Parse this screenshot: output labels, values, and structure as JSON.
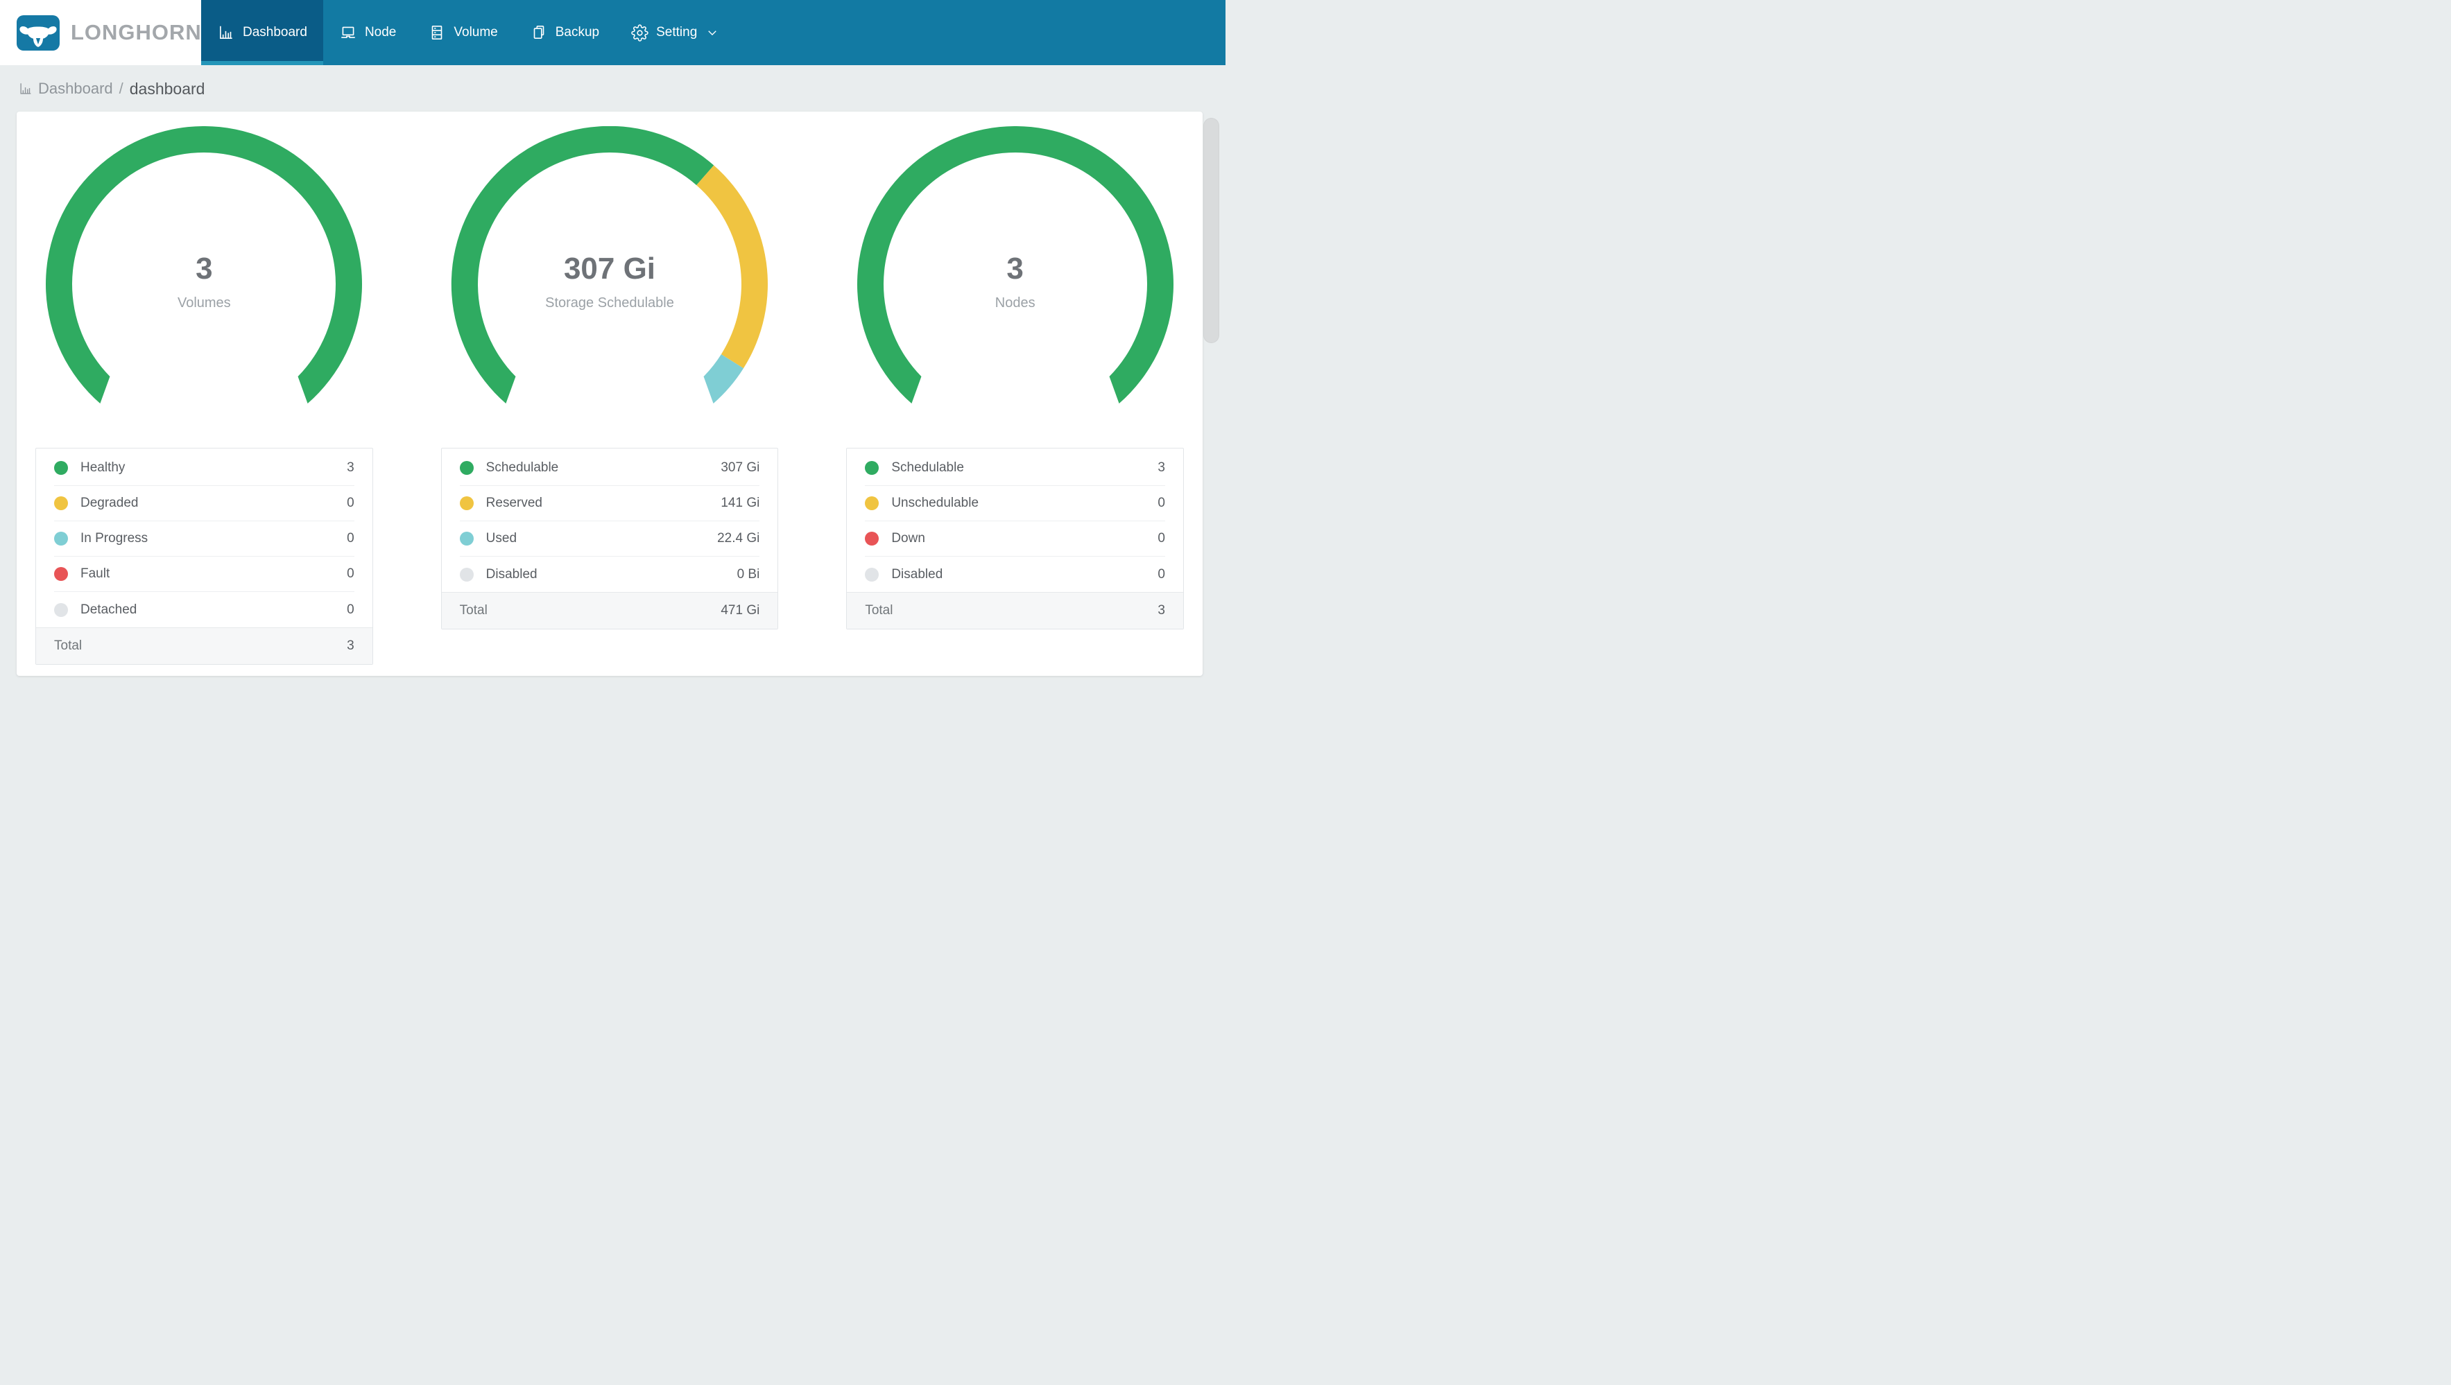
{
  "brand": {
    "name": "LONGHORN"
  },
  "nav": {
    "items": [
      {
        "label": "Dashboard",
        "icon": "bar-chart-icon",
        "active": true
      },
      {
        "label": "Node",
        "icon": "laptop-icon",
        "active": false
      },
      {
        "label": "Volume",
        "icon": "server-icon",
        "active": false
      },
      {
        "label": "Backup",
        "icon": "copy-icon",
        "active": false
      },
      {
        "label": "Setting",
        "icon": "gear-icon",
        "active": false,
        "dropdown": true
      }
    ]
  },
  "breadcrumb": {
    "icon": "bar-chart-icon",
    "section": "Dashboard",
    "separator": "/",
    "page": "dashboard"
  },
  "colors": {
    "green": "#2fab61",
    "yellow": "#f0c441",
    "teal": "#7fced4",
    "red": "#e85456",
    "gray": "#e1e4e7",
    "nav_bg": "#127aa3",
    "nav_active_bg": "#0a5c87",
    "nav_active_underline": "#2495b8"
  },
  "chart_data": [
    {
      "type": "donut-gauge",
      "name": "volumes",
      "center_value": "3",
      "center_label": "Volumes",
      "start_angle_deg": 135,
      "sweep_deg": 270,
      "segments": [
        {
          "label": "Healthy",
          "value": 3,
          "color": "green"
        }
      ],
      "legend_rows": [
        {
          "label": "Healthy",
          "value": "3",
          "color": "green"
        },
        {
          "label": "Degraded",
          "value": "0",
          "color": "yellow"
        },
        {
          "label": "In Progress",
          "value": "0",
          "color": "teal"
        },
        {
          "label": "Fault",
          "value": "0",
          "color": "red"
        },
        {
          "label": "Detached",
          "value": "0",
          "color": "gray"
        }
      ],
      "total_label": "Total",
      "total_value": "3"
    },
    {
      "type": "donut-gauge",
      "name": "storage-schedulable",
      "center_value": "307 Gi",
      "center_label": "Storage Schedulable",
      "start_angle_deg": 135,
      "sweep_deg": 270,
      "segments": [
        {
          "label": "Schedulable",
          "value": 307,
          "color": "green"
        },
        {
          "label": "Reserved",
          "value": 141,
          "color": "yellow"
        },
        {
          "label": "Used",
          "value": 22.4,
          "color": "teal"
        }
      ],
      "legend_rows": [
        {
          "label": "Schedulable",
          "value": "307 Gi",
          "color": "green"
        },
        {
          "label": "Reserved",
          "value": "141 Gi",
          "color": "yellow"
        },
        {
          "label": "Used",
          "value": "22.4 Gi",
          "color": "teal"
        },
        {
          "label": "Disabled",
          "value": "0 Bi",
          "color": "gray"
        }
      ],
      "total_label": "Total",
      "total_value": "471 Gi"
    },
    {
      "type": "donut-gauge",
      "name": "nodes",
      "center_value": "3",
      "center_label": "Nodes",
      "start_angle_deg": 135,
      "sweep_deg": 270,
      "segments": [
        {
          "label": "Schedulable",
          "value": 3,
          "color": "green"
        }
      ],
      "legend_rows": [
        {
          "label": "Schedulable",
          "value": "3",
          "color": "green"
        },
        {
          "label": "Unschedulable",
          "value": "0",
          "color": "yellow"
        },
        {
          "label": "Down",
          "value": "0",
          "color": "red"
        },
        {
          "label": "Disabled",
          "value": "0",
          "color": "gray"
        }
      ],
      "total_label": "Total",
      "total_value": "3"
    }
  ]
}
